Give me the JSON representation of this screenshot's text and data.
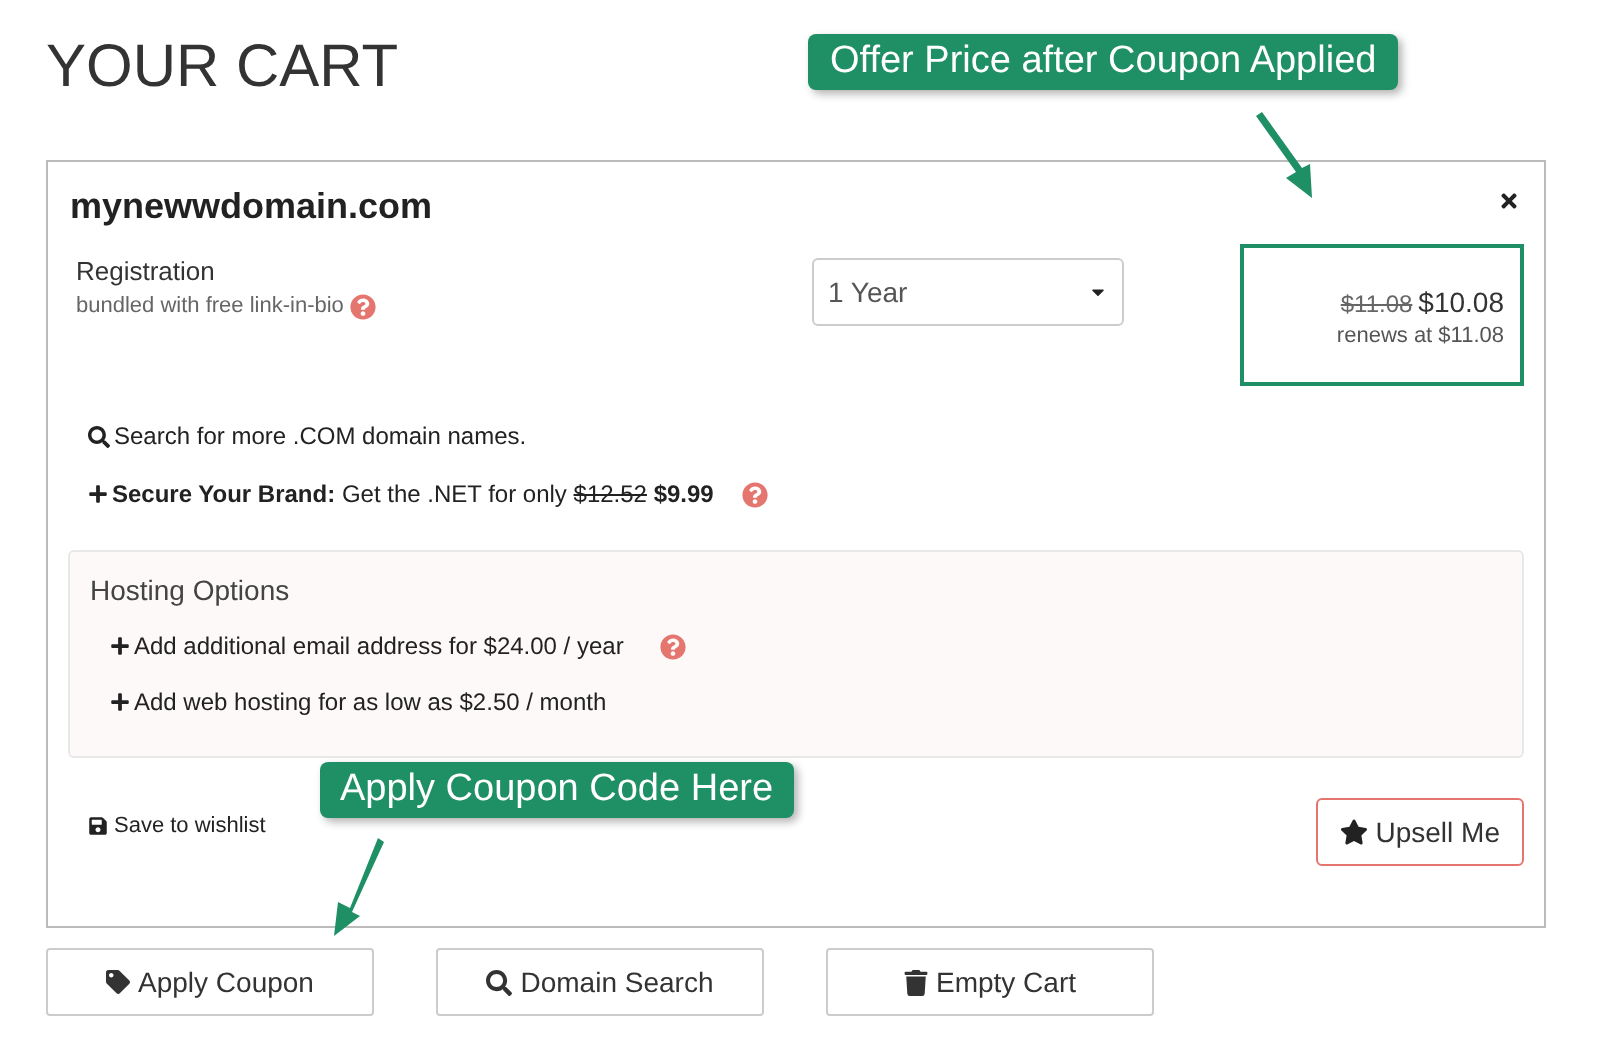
{
  "page_title": "YOUR CART",
  "cart_item": {
    "domain": "mynewwdomain.com",
    "registration": {
      "label": "Registration",
      "note": "bundled with free link-in-bio",
      "term": "1 Year"
    },
    "price": {
      "original": "$11.08",
      "current": "$10.08",
      "renews": "renews at $11.08"
    },
    "search_link": "Search for more .COM domain names.",
    "upsell_line": {
      "lead": "Secure Your Brand:",
      "text": "Get the .NET for only",
      "old_price": "$12.52",
      "new_price": "$9.99"
    },
    "hosting": {
      "title": "Hosting Options",
      "items": [
        {
          "text": "Add additional email address for $24.00 / year",
          "help": true
        },
        {
          "text": "Add web hosting for as low as $2.50 / month",
          "help": false
        }
      ]
    },
    "wishlist": "Save to wishlist",
    "upsell_button": "Upsell Me"
  },
  "buttons": [
    {
      "kind": "coupon",
      "label": "Apply Coupon"
    },
    {
      "kind": "search",
      "label": "Domain Search"
    },
    {
      "kind": "trash",
      "label": "Empty Cart"
    }
  ],
  "annotations": [
    {
      "kind": "price",
      "text": "Offer Price after Coupon Applied"
    },
    {
      "kind": "coupon",
      "text": "Apply Coupon Code Here"
    }
  ]
}
